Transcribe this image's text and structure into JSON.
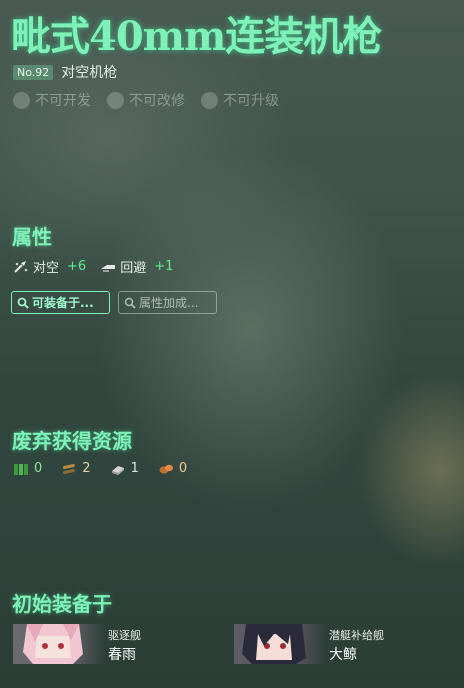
{
  "equipment": {
    "name": "毗式40mm连装机枪",
    "number": "No.92",
    "type": "对空机枪"
  },
  "flags": [
    {
      "label": "不可开发",
      "icon": "circle-icon"
    },
    {
      "label": "不可改修",
      "icon": "circle-icon"
    },
    {
      "label": "不可升级",
      "icon": "circle-icon"
    }
  ],
  "stats": {
    "title": "属性",
    "items": [
      {
        "label": "对空",
        "value": "+6",
        "icon": "anti-air-icon"
      },
      {
        "label": "回避",
        "value": "+1",
        "icon": "evasion-icon"
      }
    ]
  },
  "buttons": {
    "equippable": "可装备于...",
    "bonus": "属性加成..."
  },
  "scrap": {
    "title": "废弃获得资源",
    "items": [
      {
        "value": "0",
        "icon": "fuel-icon"
      },
      {
        "value": "2",
        "icon": "ammo-icon"
      },
      {
        "value": "1",
        "icon": "steel-icon"
      },
      {
        "value": "0",
        "icon": "bauxite-icon"
      }
    ]
  },
  "initial": {
    "title": "初始装备于",
    "ships": [
      {
        "class": "驱逐舰",
        "name": "春雨",
        "avatar": "ship-portrait"
      },
      {
        "class": "潜艇补给舰",
        "name": "大鲸",
        "avatar": "ship-portrait"
      }
    ]
  },
  "colors": {
    "accent": "#7ef0b8",
    "stat_positive": "#5ef08e"
  }
}
